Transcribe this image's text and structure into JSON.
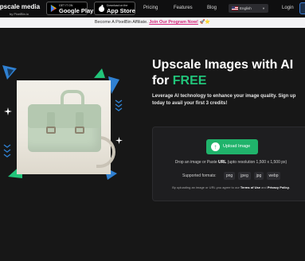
{
  "nav": {
    "brand_name": "Upscale media",
    "brand_by": "by PixelBin.io",
    "google_play": {
      "small": "GET IT ON",
      "big": "Google Play"
    },
    "app_store": {
      "small": "Download on the",
      "big": "App Store"
    },
    "links": [
      "Pricing",
      "Features",
      "Blog"
    ],
    "language": "English",
    "login": "Login"
  },
  "banner": {
    "text": "Become A PixelBin Affiliate. ",
    "cta": "Join Our Program Now!",
    "emoji": "🚀⭐"
  },
  "hero": {
    "title_line1": "Upscale Images with AI",
    "title_for": "for ",
    "title_accent": "FREE",
    "subtitle": "Leverage AI technology to enhance your image quality. Sign up today to avail your first 3 credits!"
  },
  "upload": {
    "button_label": "Upload Image",
    "drop_pre": "Drop an image or Paste ",
    "drop_url": "URL",
    "drop_post": " (upto resolution 1,500 x 1,500 px)",
    "formats_label": "Supported formats:",
    "formats": [
      "png",
      "jpeg",
      "jpg",
      "webp"
    ],
    "terms_pre": "By uploading an image or URL you agree to our ",
    "terms_link1": "Terms of Use",
    "terms_mid": " and ",
    "terms_link2": "Privacy Policy."
  },
  "colors": {
    "accent_green": "#21c47a",
    "button_green": "#20b36b",
    "banner_cta": "#d4237a",
    "deco_blue": "#2f80d1"
  }
}
